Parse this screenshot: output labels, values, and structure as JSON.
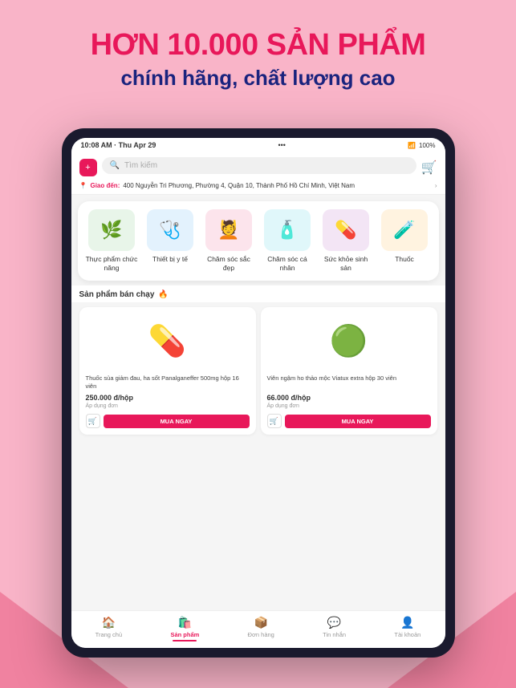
{
  "header": {
    "line1": "HƠN 10.000 SẢN PHẨM",
    "line2": "chính hãng, chất lượng cao"
  },
  "statusBar": {
    "time": "10:08 AM · Thu Apr 29",
    "wifi": "WiFi",
    "battery": "100%"
  },
  "appHeader": {
    "searchPlaceholder": "Tìm kiếm",
    "locationLabel": "Giao đến:",
    "locationAddress": "400 Nguyễn Tri Phương, Phường 4, Quận 10, Thành Phố Hồ Chí Minh, Việt Nam"
  },
  "categories": [
    {
      "id": "thuc-pham",
      "label": "Thực phẩm chức năng",
      "emoji": "🌿",
      "colorClass": "cat-green"
    },
    {
      "id": "thiet-bi",
      "label": "Thiết bị y tế",
      "emoji": "🩺",
      "colorClass": "cat-blue"
    },
    {
      "id": "cham-soc-dep",
      "label": "Chăm sóc sắc đẹp",
      "emoji": "💆",
      "colorClass": "cat-pink"
    },
    {
      "id": "cham-soc-ca-nhan",
      "label": "Chăm sóc cá nhân",
      "emoji": "🧴",
      "colorClass": "cat-mint"
    },
    {
      "id": "suc-khoe",
      "label": "Sức khỏe sinh sản",
      "emoji": "💊",
      "colorClass": "cat-purple"
    },
    {
      "id": "thuoc",
      "label": "Thuốc",
      "emoji": "🧪",
      "colorClass": "cat-orange"
    }
  ],
  "productsSection": {
    "title": "Sản phẩm bán chạy",
    "fireIcon": "🔥",
    "products": [
      {
        "name": "Thuốc sủa giảm đau, ha sốt Panalganeffer 500mg hộp 16 viên",
        "price": "250.000 đ/hộp",
        "priceNote": "Áp dụng đơn",
        "emoji": "💊",
        "buyLabel": "MUA NGAY"
      },
      {
        "name": "Viên ngậm ho thảo mộc Viatux extra hộp 30 viên",
        "price": "66.000 đ/hộp",
        "priceNote": "Áp dụng đơn",
        "emoji": "🟢",
        "buyLabel": "MUA NGAY"
      }
    ]
  },
  "bottomNav": [
    {
      "id": "home",
      "label": "Trang chủ",
      "icon": "🏠",
      "active": false
    },
    {
      "id": "products",
      "label": "Sản phẩm",
      "icon": "🛍️",
      "active": true
    },
    {
      "id": "orders",
      "label": "Đơn hàng",
      "icon": "📦",
      "active": false
    },
    {
      "id": "messages",
      "label": "Tin nhắn",
      "icon": "💬",
      "active": false
    },
    {
      "id": "account",
      "label": "Tài khoản",
      "icon": "👤",
      "active": false
    }
  ]
}
